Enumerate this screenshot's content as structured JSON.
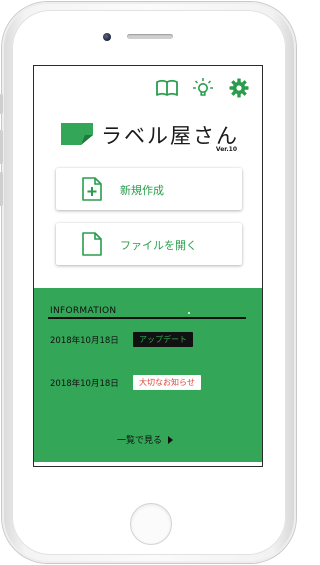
{
  "toolbar": {
    "icons": [
      "book-icon",
      "lightbulb-icon",
      "gear-icon"
    ]
  },
  "app": {
    "name": "ラベル屋さん",
    "version": "Ver.10"
  },
  "actions": {
    "new": {
      "label": "新規作成",
      "icon": "new-document-icon"
    },
    "open": {
      "label": "ファイルを開く",
      "icon": "document-icon"
    }
  },
  "info": {
    "title": "INFORMATION",
    "items": [
      {
        "date": "2018年10月18日",
        "badge": "アップデート"
      },
      {
        "date": "2018年10月18日",
        "badge": "大切なお知らせ"
      }
    ],
    "more_label": "一覧で見る"
  },
  "colors": {
    "brand_green": "#33a657",
    "alert_red": "#e0443c"
  }
}
